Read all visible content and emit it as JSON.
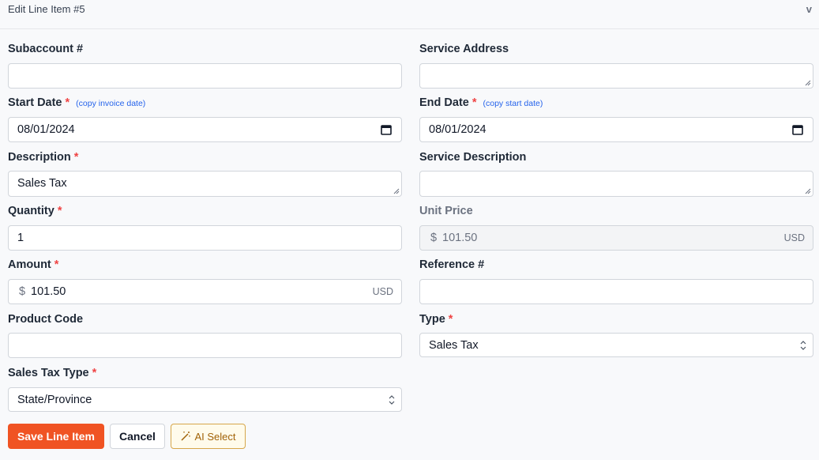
{
  "header": {
    "title": "Edit Line Item #5",
    "collapse_glyph": "v",
    "collapse_icon": "chevron-down-icon"
  },
  "fields": {
    "subaccount": {
      "label": "Subaccount #",
      "value": ""
    },
    "service_address": {
      "label": "Service Address",
      "value": ""
    },
    "start_date": {
      "label": "Start Date",
      "required": "*",
      "link": "(copy invoice date)",
      "value": "08/01/2024"
    },
    "end_date": {
      "label": "End Date",
      "required": "*",
      "link": "(copy start date)",
      "value": "08/01/2024"
    },
    "description": {
      "label": "Description",
      "required": "*",
      "value": "Sales Tax"
    },
    "service_description": {
      "label": "Service Description",
      "value": ""
    },
    "quantity": {
      "label": "Quantity",
      "required": "*",
      "value": "1"
    },
    "unit_price": {
      "label": "Unit Price",
      "currency_symbol": "$",
      "value": "101.50",
      "currency": "USD",
      "disabled": true
    },
    "amount": {
      "label": "Amount",
      "required": "*",
      "currency_symbol": "$",
      "value": "101.50",
      "currency": "USD"
    },
    "reference": {
      "label": "Reference #",
      "value": ""
    },
    "product_code": {
      "label": "Product Code",
      "value": ""
    },
    "type": {
      "label": "Type",
      "required": "*",
      "value": "Sales Tax"
    },
    "sales_tax_type": {
      "label": "Sales Tax Type",
      "required": "*",
      "value": "State/Province"
    }
  },
  "actions": {
    "save_label": "Save Line Item",
    "cancel_label": "Cancel",
    "ai_label": "AI Select",
    "ai_icon": "magic-wand-icon"
  },
  "colors": {
    "accent": "#f05323",
    "required": "#ef4444",
    "link": "#2563eb",
    "ai_border": "#d6a64a",
    "ai_text": "#a16207"
  }
}
